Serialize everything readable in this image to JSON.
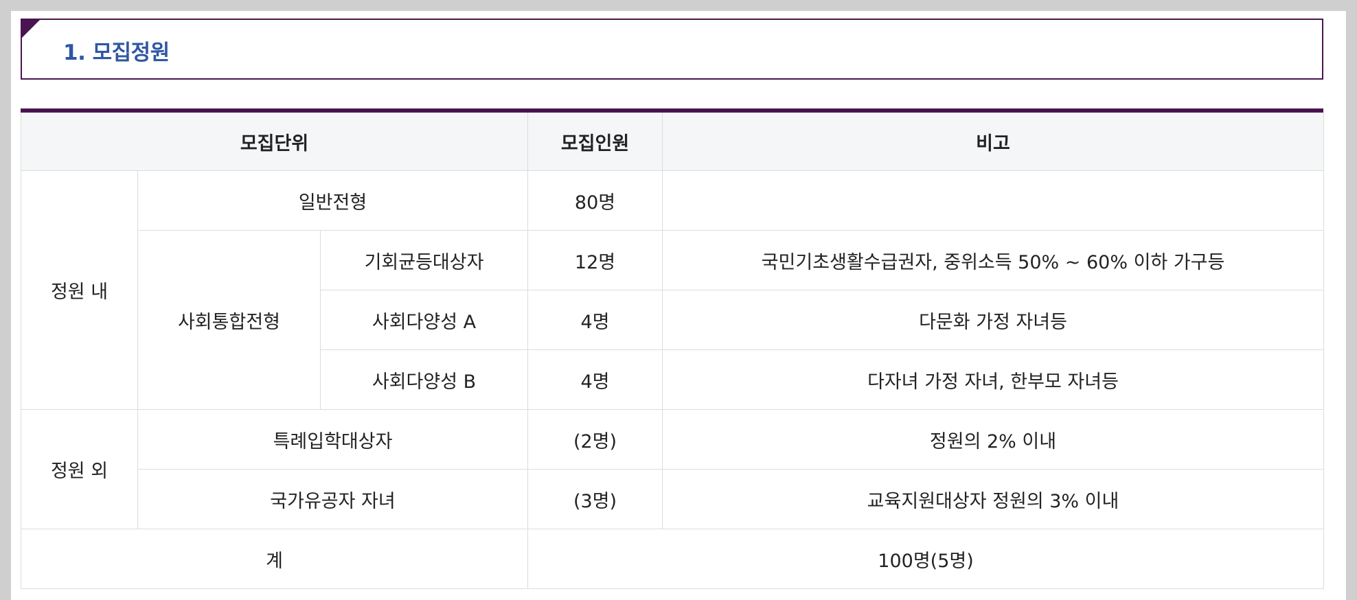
{
  "section": {
    "title": "1. 모집정원"
  },
  "table": {
    "headers": {
      "unit": "모집단위",
      "count": "모집인원",
      "note": "비고"
    },
    "groups": {
      "inside": "정원 내",
      "outside": "정원 외"
    },
    "rows": [
      {
        "name": "일반전형",
        "count": "80명",
        "note": ""
      },
      {
        "subgroup": "사회통합전형",
        "name": "기회균등대상자",
        "count": "12명",
        "note": "국민기초생활수급권자, 중위소득 50% ~ 60% 이하 가구등"
      },
      {
        "name": "사회다양성 A",
        "count": "4명",
        "note": "다문화 가정 자녀등"
      },
      {
        "name": "사회다양성 B",
        "count": "4명",
        "note": "다자녀 가정 자녀, 한부모 자녀등"
      },
      {
        "name": "특례입학대상자",
        "count": "(2명)",
        "note": "정원의 2% 이내"
      },
      {
        "name": "국가유공자 자녀",
        "count": "(3명)",
        "note": "교육지원대상자 정원의 3% 이내"
      }
    ],
    "total": {
      "label": "계",
      "value": "100명(5명)"
    }
  },
  "colors": {
    "accent": "#4a1450",
    "title": "#2f57a3",
    "header_bg": "#f5f6f8",
    "border": "#dcdcdc"
  }
}
